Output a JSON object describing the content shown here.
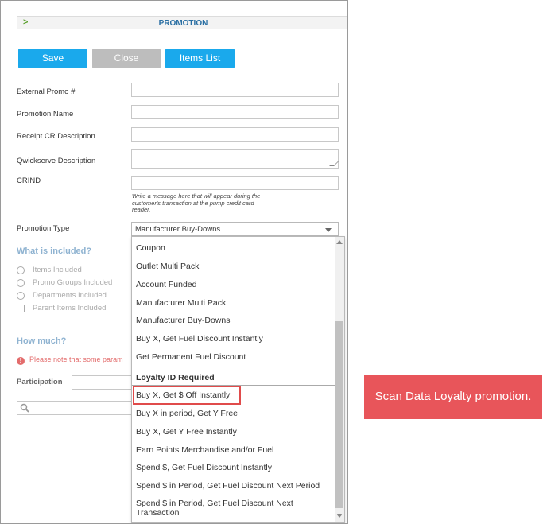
{
  "header": {
    "title": "PROMOTION",
    "chevron": ">"
  },
  "toolbar": {
    "save": "Save",
    "close": "Close",
    "items_list": "Items List"
  },
  "form": {
    "external_promo_label": "External Promo #",
    "promotion_name_label": "Promotion Name",
    "receipt_cr_label": "Receipt CR Description",
    "qwickserve_label": "Qwickserve Description",
    "crind_label": "CRIND",
    "crind_helper": "Write a message here that will appear during the customer's transaction at the pump credit card reader.",
    "promotion_type_label": "Promotion Type",
    "promotion_type_value": "Manufacturer Buy-Downs"
  },
  "included": {
    "title": "What is included?",
    "options": [
      "Items Included",
      "Promo Groups Included",
      "Departments Included"
    ],
    "checkbox": "Parent Items Included"
  },
  "how_much": {
    "title": "How much?",
    "notice": "Please note that some param",
    "participation_label": "Participation"
  },
  "dropdown": {
    "items": [
      "Coupon",
      "Outlet Multi Pack",
      "Account Funded",
      "Manufacturer Multi Pack",
      "Manufacturer Buy-Downs",
      "Buy X, Get Fuel Discount Instantly",
      "Get Permanent Fuel Discount"
    ],
    "group_label": "Loyalty ID Required",
    "loyalty_items": [
      "Buy X, Get $ Off Instantly",
      "Buy X in period, Get Y Free",
      "Buy X, Get Y Free Instantly",
      "Earn Points Merchandise and/or Fuel",
      "Spend $, Get Fuel Discount Instantly",
      "Spend $ in Period, Get Fuel Discount Next Period",
      "Spend $ in Period, Get Fuel Discount Next Transaction"
    ]
  },
  "callout": {
    "text": "Scan Data Loyalty promotion.",
    "color": "#e8555a"
  },
  "colors": {
    "primary": "#1aa9ec",
    "disabled": "#bdbdbd",
    "highlight": "#e04b4b"
  }
}
